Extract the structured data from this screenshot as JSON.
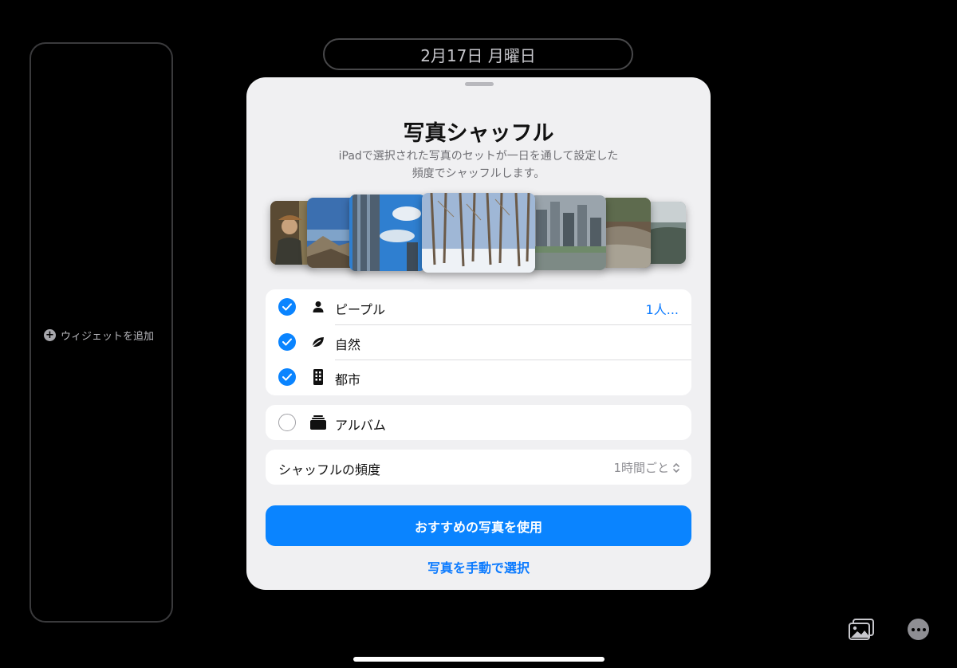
{
  "date_pill": {
    "text": "2月17日 月曜日"
  },
  "widget_column": {
    "add_label": "ウィジェットを追加"
  },
  "sheet": {
    "title": "写真シャッフル",
    "description_line1": "iPadで選択された写真のセットが一日を通して設定した",
    "description_line2": "頻度でシャッフルします。",
    "categories": [
      {
        "label": "ピープル",
        "checked": true,
        "icon": "person-icon",
        "value": "1人..."
      },
      {
        "label": "自然",
        "checked": true,
        "icon": "leaf-icon",
        "value": ""
      },
      {
        "label": "都市",
        "checked": true,
        "icon": "building-icon",
        "value": ""
      }
    ],
    "album": {
      "label": "アルバム",
      "checked": false,
      "icon": "album-stack-icon"
    },
    "frequency": {
      "label": "シャッフルの頻度",
      "value": "1時間ごと"
    },
    "primary_button": "おすすめの写真を使用",
    "link_button": "写真を手動で選択"
  },
  "colors": {
    "accent": "#0a84ff",
    "sheet_background": "#f0f0f2",
    "screen_background": "#000000"
  }
}
